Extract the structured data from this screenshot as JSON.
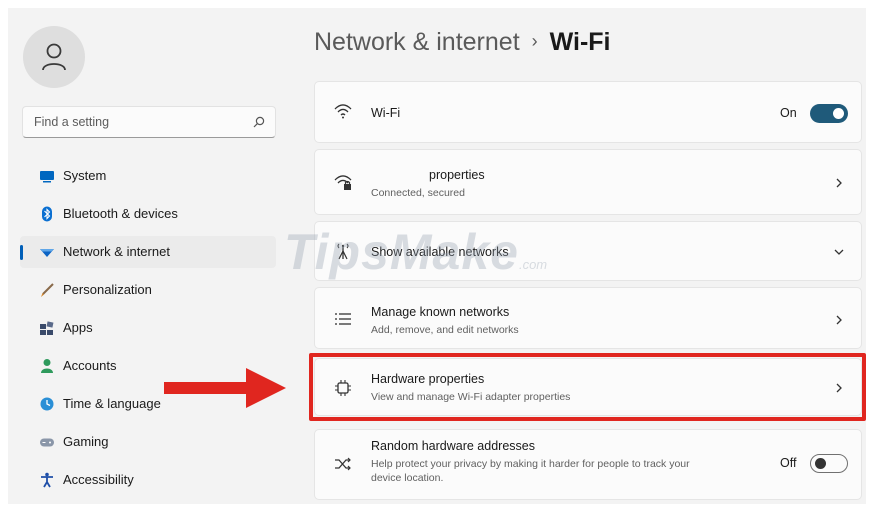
{
  "sidebar": {
    "search_placeholder": "Find a setting",
    "items": [
      {
        "label": "System",
        "icon": "monitor-icon"
      },
      {
        "label": "Bluetooth & devices",
        "icon": "bluetooth-icon"
      },
      {
        "label": "Network & internet",
        "icon": "wifi-diamond-icon",
        "selected": true
      },
      {
        "label": "Personalization",
        "icon": "brush-icon"
      },
      {
        "label": "Apps",
        "icon": "apps-icon"
      },
      {
        "label": "Accounts",
        "icon": "person-icon"
      },
      {
        "label": "Time & language",
        "icon": "globe-clock-icon"
      },
      {
        "label": "Gaming",
        "icon": "gamepad-icon"
      },
      {
        "label": "Accessibility",
        "icon": "accessibility-icon"
      }
    ]
  },
  "header": {
    "parent": "Network & internet",
    "separator": "›",
    "current": "Wi-Fi"
  },
  "cards": {
    "wifi": {
      "title": "Wi-Fi",
      "toggle_label": "On",
      "toggle_on": true
    },
    "connection": {
      "title": "properties",
      "subtitle": "Connected, secured"
    },
    "available": {
      "title": "Show available networks"
    },
    "known": {
      "title": "Manage known networks",
      "subtitle": "Add, remove, and edit networks"
    },
    "hardware": {
      "title": "Hardware properties",
      "subtitle": "View and manage Wi-Fi adapter properties"
    },
    "random": {
      "title": "Random hardware addresses",
      "subtitle": "Help protect your privacy by making it harder for people to track your device location.",
      "toggle_label": "Off",
      "toggle_on": false
    }
  },
  "overlay": {
    "watermark": "TipsMake",
    "watermark_suffix": ".com",
    "highlight_color": "#e0261f",
    "arrow_color": "#e0261f"
  },
  "colors": {
    "accent": "#005fb8",
    "toggle_on": "#1f5a7a",
    "background": "#f3f3f3"
  }
}
